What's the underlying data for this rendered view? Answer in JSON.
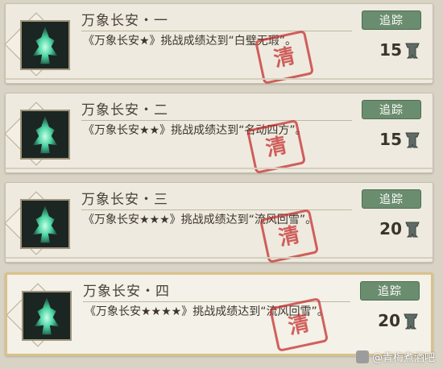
{
  "achievements": [
    {
      "title": "万象长安・一",
      "description": "《万象长安★》挑战成绩达到“白璧无瑕”。",
      "track_label": "追踪",
      "reward": "15"
    },
    {
      "title": "万象长安・二",
      "description": "《万象长安★★》挑战成绩达到“名动四方”。",
      "track_label": "追踪",
      "reward": "15"
    },
    {
      "title": "万象长安・三",
      "description": "《万象长安★★★》挑战成绩达到“流风回雪”。",
      "track_label": "追踪",
      "reward": "20"
    },
    {
      "title": "万象长安・四",
      "description": "《万象长安★★★★》挑战成绩达到“流风回雪”。",
      "track_label": "追踪",
      "reward": "20"
    }
  ],
  "stamp_text": "清",
  "watermark": "@青梅煮酒吧",
  "icons": {
    "achievement": "jade-tree-icon",
    "reward": "bronze-vessel-icon"
  },
  "colors": {
    "track_button": "#6b8d6f",
    "stamp": "#c42828",
    "card_bg": "#eeeadf",
    "selected_border": "#d9c28a"
  }
}
